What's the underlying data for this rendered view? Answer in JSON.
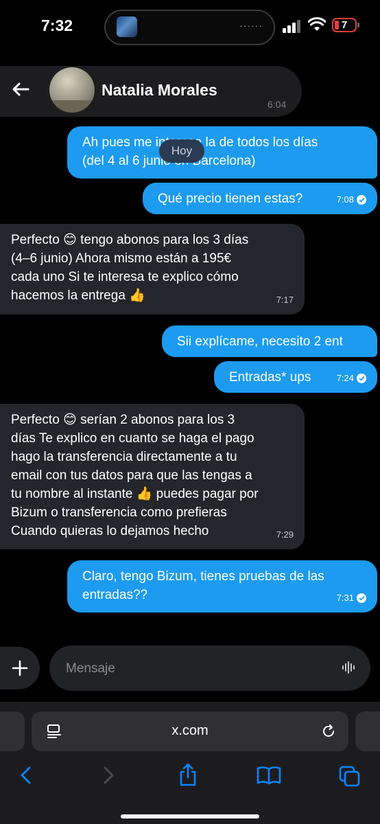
{
  "status": {
    "time": "7:32",
    "battery": "7"
  },
  "header": {
    "back": "back",
    "name": "Natalia Morales",
    "time": "6:04"
  },
  "day_divider": "Hoy",
  "messages": [
    {
      "dir": "out",
      "lines": [
        "Ah pues me interesa la de todos los días",
        "(del 4 al 6 junio en Barcelona)"
      ],
      "time": ""
    },
    {
      "dir": "out",
      "lines": [
        "Qué precio tienen estas?"
      ],
      "time": "7:08"
    },
    {
      "dir": "in",
      "lines": [
        "Perfecto 😊 tengo abonos para los 3 días",
        "(4–6 junio) Ahora mismo están a 195€",
        "cada uno Si te interesa te explico cómo",
        "hacemos la entrega 👍"
      ],
      "time": "7:17"
    },
    {
      "dir": "out",
      "lines": [
        "Sii explícame, necesito 2 ent"
      ],
      "time": ""
    },
    {
      "dir": "out",
      "lines": [
        "Entradas* ups"
      ],
      "time": "7:24"
    },
    {
      "dir": "in",
      "lines": [
        "Perfecto 😊 serían 2 abonos para los 3",
        "días Te explico en cuanto se haga el pago",
        "hago la transferencia directamente a tu",
        "email con tus datos para que las tengas a",
        "tu nombre al instante 👍 puedes pagar por",
        "Bizum o transferencia como prefieras",
        "Cuando quieras lo dejamos hecho"
      ],
      "time": "7:29"
    },
    {
      "dir": "out",
      "lines": [
        "Claro, tengo Bizum, tienes pruebas de las",
        "entradas??"
      ],
      "time": "7:31"
    }
  ],
  "composer": {
    "placeholder": "Mensaje"
  },
  "browser": {
    "url": "x.com"
  },
  "icons": [
    "back-arrow-icon",
    "plus-icon",
    "voice-wave-icon",
    "reader-icon",
    "reload-icon",
    "back-chevron-icon",
    "forward-chevron-icon",
    "share-icon",
    "bookmarks-icon",
    "tabs-icon"
  ],
  "colors": {
    "outgoing": "#1d9bf0",
    "incoming": "#25262b",
    "background": "#000000",
    "browser_bar": "#1c1c1e"
  }
}
